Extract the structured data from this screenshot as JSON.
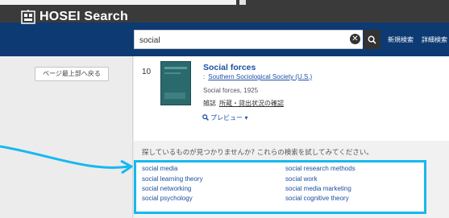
{
  "header": {
    "brand": "HOSEI Search",
    "search_value": "social",
    "clear_glyph": "✕",
    "links": [
      "新規検索",
      "詳細検索"
    ]
  },
  "sidebar": {
    "back_to_top": "ページ最上部へ戻る"
  },
  "result": {
    "number": "10",
    "title": "Social forces",
    "author_colon": ":",
    "author": "Southern Sociological Society (U.S.)",
    "pub": "Social forces, 1925",
    "holdings_label": "雑誌",
    "holdings_link": "所蔵・貸出状況の確認",
    "preview": "プレビュー ▾"
  },
  "suggestions": {
    "prompt": "探しているものが見つかりませんか? これらの検索を試してみてください。",
    "left": [
      "social media",
      "social learning theory",
      "social networking",
      "social psychology"
    ],
    "right": [
      "social research methods",
      "social work",
      "social media marketing",
      "social cognitive theory"
    ]
  },
  "icons": [
    "logo-icon",
    "search-icon",
    "clear-icon",
    "preview-icon"
  ],
  "colors": {
    "header_bg": "#0d3a73",
    "link": "#1d4fa3",
    "highlight": "#17b8f0"
  }
}
